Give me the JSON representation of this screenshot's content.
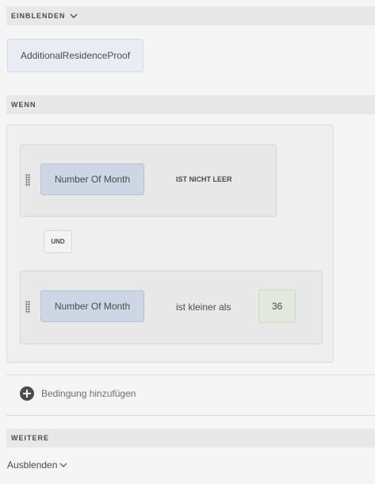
{
  "show_section": {
    "title": "EINBLENDEN",
    "target_chip": "AdditionalResidenceProof"
  },
  "when_section": {
    "title": "WENN",
    "conditions": [
      {
        "field": "Number Of Month",
        "operator": "IST NICHT LEER"
      },
      {
        "field": "Number Of Month",
        "operator": "ist kleiner als",
        "value": "36"
      }
    ],
    "connector": "UND",
    "add_condition_label": "Bedingung hinzufügen"
  },
  "more_section": {
    "title": "WEITERE",
    "action_dropdown": "Ausblenden"
  },
  "icons": {
    "add": "plus-circle-icon",
    "grip": "drag-handle-icon",
    "expand": "chevron-down-icon"
  }
}
